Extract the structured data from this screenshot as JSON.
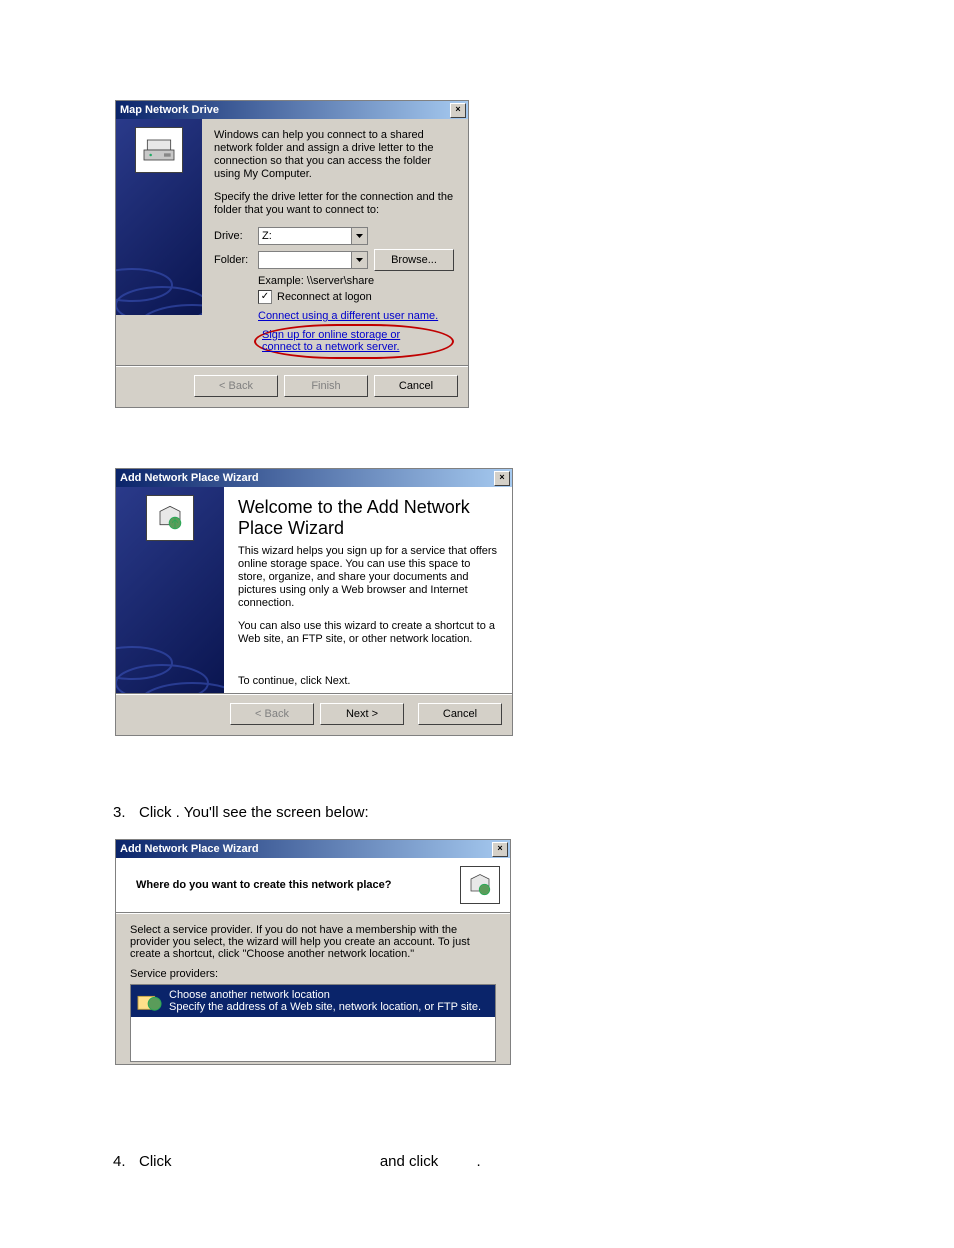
{
  "dialog1": {
    "title": "Map Network Drive",
    "intro1": "Windows can help you connect to a shared network folder and assign a drive letter to the connection so that you can access the folder using My Computer.",
    "intro2": "Specify the drive letter for the connection and the folder that you want to connect to:",
    "drive_label": "Drive:",
    "drive_value": "Z:",
    "folder_label": "Folder:",
    "folder_value": "",
    "browse_btn": "Browse...",
    "example_text": "Example: \\\\server\\share",
    "reconnect_label": "Reconnect at logon",
    "link1": "Connect using a different user name.",
    "link2": "Sign up for online storage or connect to a network server.",
    "back_btn": "< Back",
    "finish_btn": "Finish",
    "cancel_btn": "Cancel"
  },
  "dialog2": {
    "title": "Add Network Place Wizard",
    "heading": "Welcome to the Add Network Place Wizard",
    "p1": "This wizard helps you sign up for a service that offers online storage space. You can use this space to store, organize, and share your documents and pictures using only a Web browser and Internet connection.",
    "p2": "You can also use this wizard to create a shortcut to a Web site, an FTP site, or other network location.",
    "continue_text": "To continue, click Next.",
    "back_btn": "< Back",
    "next_btn": "Next >",
    "cancel_btn": "Cancel"
  },
  "step3": {
    "num": "3.",
    "text_a": "Click ",
    "text_b": ". You'll see the screen below:"
  },
  "dialog3": {
    "title": "Add Network Place Wizard",
    "header_q": "Where do you want to create this network place?",
    "desc": "Select a service provider. If you do not have a membership with the provider you select, the wizard will help you create an account. To just create a shortcut, click \"Choose another network location.\"",
    "sp_label": "Service providers:",
    "item_title": "Choose another network location",
    "item_sub": "Specify the address of a Web site, network location, or FTP site."
  },
  "step4": {
    "num": "4.",
    "text_a": "Click ",
    "text_b": " and click ",
    "text_c": "."
  }
}
